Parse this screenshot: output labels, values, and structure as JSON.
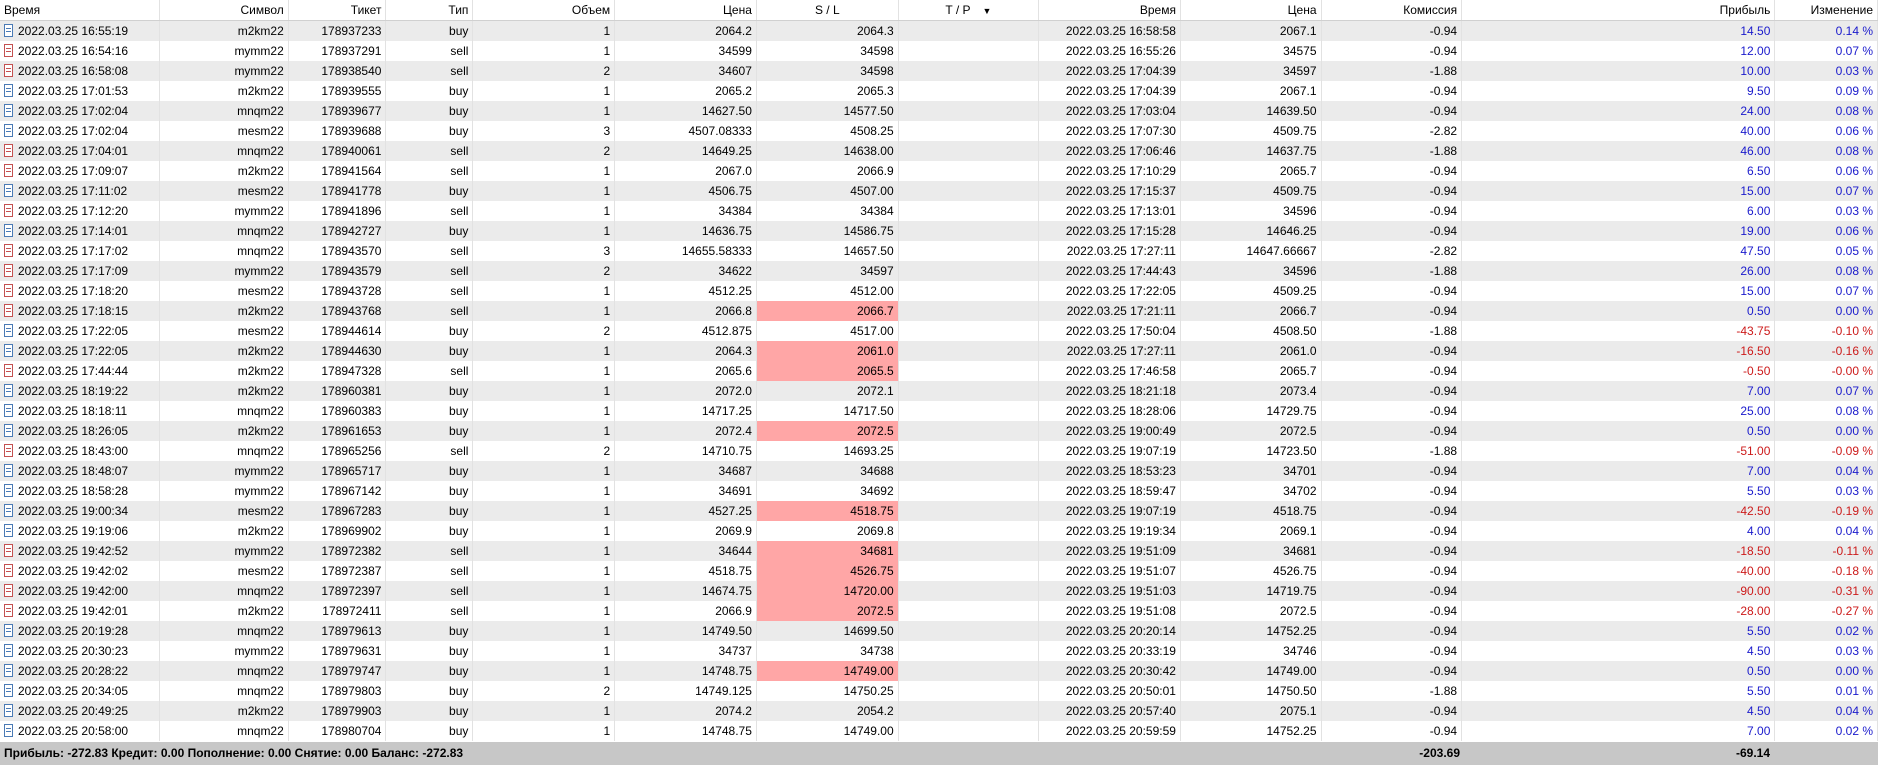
{
  "columns": [
    "Время",
    "Символ",
    "Тикет",
    "Тип",
    "Объем",
    "Цена",
    "S / L",
    "T / P",
    "Время",
    "Цена",
    "Комиссия",
    "Прибыль",
    "Изменение"
  ],
  "sort_indicator": "▼",
  "rows": [
    {
      "open_time": "2022.03.25 16:55:19",
      "symbol": "m2km22",
      "ticket": "178937233",
      "type": "buy",
      "volume": "1",
      "open_price": "2064.2",
      "sl": "2064.3",
      "tp": "",
      "close_time": "2022.03.25 16:58:58",
      "close_price": "2067.1",
      "commission": "-0.94",
      "profit": "14.50",
      "change": "0.14 %",
      "sl_hit": false
    },
    {
      "open_time": "2022.03.25 16:54:16",
      "symbol": "mymm22",
      "ticket": "178937291",
      "type": "sell",
      "volume": "1",
      "open_price": "34599",
      "sl": "34598",
      "tp": "",
      "close_time": "2022.03.25 16:55:26",
      "close_price": "34575",
      "commission": "-0.94",
      "profit": "12.00",
      "change": "0.07 %",
      "sl_hit": false
    },
    {
      "open_time": "2022.03.25 16:58:08",
      "symbol": "mymm22",
      "ticket": "178938540",
      "type": "sell",
      "volume": "2",
      "open_price": "34607",
      "sl": "34598",
      "tp": "",
      "close_time": "2022.03.25 17:04:39",
      "close_price": "34597",
      "commission": "-1.88",
      "profit": "10.00",
      "change": "0.03 %",
      "sl_hit": false
    },
    {
      "open_time": "2022.03.25 17:01:53",
      "symbol": "m2km22",
      "ticket": "178939555",
      "type": "buy",
      "volume": "1",
      "open_price": "2065.2",
      "sl": "2065.3",
      "tp": "",
      "close_time": "2022.03.25 17:04:39",
      "close_price": "2067.1",
      "commission": "-0.94",
      "profit": "9.50",
      "change": "0.09 %",
      "sl_hit": false
    },
    {
      "open_time": "2022.03.25 17:02:04",
      "symbol": "mnqm22",
      "ticket": "178939677",
      "type": "buy",
      "volume": "1",
      "open_price": "14627.50",
      "sl": "14577.50",
      "tp": "",
      "close_time": "2022.03.25 17:03:04",
      "close_price": "14639.50",
      "commission": "-0.94",
      "profit": "24.00",
      "change": "0.08 %",
      "sl_hit": false
    },
    {
      "open_time": "2022.03.25 17:02:04",
      "symbol": "mesm22",
      "ticket": "178939688",
      "type": "buy",
      "volume": "3",
      "open_price": "4507.08333",
      "sl": "4508.25",
      "tp": "",
      "close_time": "2022.03.25 17:07:30",
      "close_price": "4509.75",
      "commission": "-2.82",
      "profit": "40.00",
      "change": "0.06 %",
      "sl_hit": false
    },
    {
      "open_time": "2022.03.25 17:04:01",
      "symbol": "mnqm22",
      "ticket": "178940061",
      "type": "sell",
      "volume": "2",
      "open_price": "14649.25",
      "sl": "14638.00",
      "tp": "",
      "close_time": "2022.03.25 17:06:46",
      "close_price": "14637.75",
      "commission": "-1.88",
      "profit": "46.00",
      "change": "0.08 %",
      "sl_hit": false
    },
    {
      "open_time": "2022.03.25 17:09:07",
      "symbol": "m2km22",
      "ticket": "178941564",
      "type": "sell",
      "volume": "1",
      "open_price": "2067.0",
      "sl": "2066.9",
      "tp": "",
      "close_time": "2022.03.25 17:10:29",
      "close_price": "2065.7",
      "commission": "-0.94",
      "profit": "6.50",
      "change": "0.06 %",
      "sl_hit": false
    },
    {
      "open_time": "2022.03.25 17:11:02",
      "symbol": "mesm22",
      "ticket": "178941778",
      "type": "buy",
      "volume": "1",
      "open_price": "4506.75",
      "sl": "4507.00",
      "tp": "",
      "close_time": "2022.03.25 17:15:37",
      "close_price": "4509.75",
      "commission": "-0.94",
      "profit": "15.00",
      "change": "0.07 %",
      "sl_hit": false
    },
    {
      "open_time": "2022.03.25 17:12:20",
      "symbol": "mymm22",
      "ticket": "178941896",
      "type": "sell",
      "volume": "1",
      "open_price": "34384",
      "sl": "34384",
      "tp": "",
      "close_time": "2022.03.25 17:13:01",
      "close_price": "34596",
      "commission": "-0.94",
      "profit": "6.00",
      "change": "0.03 %",
      "sl_hit": false
    },
    {
      "open_time": "2022.03.25 17:14:01",
      "symbol": "mnqm22",
      "ticket": "178942727",
      "type": "buy",
      "volume": "1",
      "open_price": "14636.75",
      "sl": "14586.75",
      "tp": "",
      "close_time": "2022.03.25 17:15:28",
      "close_price": "14646.25",
      "commission": "-0.94",
      "profit": "19.00",
      "change": "0.06 %",
      "sl_hit": false
    },
    {
      "open_time": "2022.03.25 17:17:02",
      "symbol": "mnqm22",
      "ticket": "178943570",
      "type": "sell",
      "volume": "3",
      "open_price": "14655.58333",
      "sl": "14657.50",
      "tp": "",
      "close_time": "2022.03.25 17:27:11",
      "close_price": "14647.66667",
      "commission": "-2.82",
      "profit": "47.50",
      "change": "0.05 %",
      "sl_hit": false
    },
    {
      "open_time": "2022.03.25 17:17:09",
      "symbol": "mymm22",
      "ticket": "178943579",
      "type": "sell",
      "volume": "2",
      "open_price": "34622",
      "sl": "34597",
      "tp": "",
      "close_time": "2022.03.25 17:44:43",
      "close_price": "34596",
      "commission": "-1.88",
      "profit": "26.00",
      "change": "0.08 %",
      "sl_hit": false
    },
    {
      "open_time": "2022.03.25 17:18:20",
      "symbol": "mesm22",
      "ticket": "178943728",
      "type": "sell",
      "volume": "1",
      "open_price": "4512.25",
      "sl": "4512.00",
      "tp": "",
      "close_time": "2022.03.25 17:22:05",
      "close_price": "4509.25",
      "commission": "-0.94",
      "profit": "15.00",
      "change": "0.07 %",
      "sl_hit": false
    },
    {
      "open_time": "2022.03.25 17:18:15",
      "symbol": "m2km22",
      "ticket": "178943768",
      "type": "sell",
      "volume": "1",
      "open_price": "2066.8",
      "sl": "2066.7",
      "tp": "",
      "close_time": "2022.03.25 17:21:11",
      "close_price": "2066.7",
      "commission": "-0.94",
      "profit": "0.50",
      "change": "0.00 %",
      "sl_hit": true
    },
    {
      "open_time": "2022.03.25 17:22:05",
      "symbol": "mesm22",
      "ticket": "178944614",
      "type": "buy",
      "volume": "2",
      "open_price": "4512.875",
      "sl": "4517.00",
      "tp": "",
      "close_time": "2022.03.25 17:50:04",
      "close_price": "4508.50",
      "commission": "-1.88",
      "profit": "-43.75",
      "change": "-0.10 %",
      "sl_hit": false
    },
    {
      "open_time": "2022.03.25 17:22:05",
      "symbol": "m2km22",
      "ticket": "178944630",
      "type": "buy",
      "volume": "1",
      "open_price": "2064.3",
      "sl": "2061.0",
      "tp": "",
      "close_time": "2022.03.25 17:27:11",
      "close_price": "2061.0",
      "commission": "-0.94",
      "profit": "-16.50",
      "change": "-0.16 %",
      "sl_hit": true
    },
    {
      "open_time": "2022.03.25 17:44:44",
      "symbol": "m2km22",
      "ticket": "178947328",
      "type": "sell",
      "volume": "1",
      "open_price": "2065.6",
      "sl": "2065.5",
      "tp": "",
      "close_time": "2022.03.25 17:46:58",
      "close_price": "2065.7",
      "commission": "-0.94",
      "profit": "-0.50",
      "change": "-0.00 %",
      "sl_hit": true
    },
    {
      "open_time": "2022.03.25 18:19:22",
      "symbol": "m2km22",
      "ticket": "178960381",
      "type": "buy",
      "volume": "1",
      "open_price": "2072.0",
      "sl": "2072.1",
      "tp": "",
      "close_time": "2022.03.25 18:21:18",
      "close_price": "2073.4",
      "commission": "-0.94",
      "profit": "7.00",
      "change": "0.07 %",
      "sl_hit": false
    },
    {
      "open_time": "2022.03.25 18:18:11",
      "symbol": "mnqm22",
      "ticket": "178960383",
      "type": "buy",
      "volume": "1",
      "open_price": "14717.25",
      "sl": "14717.50",
      "tp": "",
      "close_time": "2022.03.25 18:28:06",
      "close_price": "14729.75",
      "commission": "-0.94",
      "profit": "25.00",
      "change": "0.08 %",
      "sl_hit": false
    },
    {
      "open_time": "2022.03.25 18:26:05",
      "symbol": "m2km22",
      "ticket": "178961653",
      "type": "buy",
      "volume": "1",
      "open_price": "2072.4",
      "sl": "2072.5",
      "tp": "",
      "close_time": "2022.03.25 19:00:49",
      "close_price": "2072.5",
      "commission": "-0.94",
      "profit": "0.50",
      "change": "0.00 %",
      "sl_hit": true
    },
    {
      "open_time": "2022.03.25 18:43:00",
      "symbol": "mnqm22",
      "ticket": "178965256",
      "type": "sell",
      "volume": "2",
      "open_price": "14710.75",
      "sl": "14693.25",
      "tp": "",
      "close_time": "2022.03.25 19:07:19",
      "close_price": "14723.50",
      "commission": "-1.88",
      "profit": "-51.00",
      "change": "-0.09 %",
      "sl_hit": false
    },
    {
      "open_time": "2022.03.25 18:48:07",
      "symbol": "mymm22",
      "ticket": "178965717",
      "type": "buy",
      "volume": "1",
      "open_price": "34687",
      "sl": "34688",
      "tp": "",
      "close_time": "2022.03.25 18:53:23",
      "close_price": "34701",
      "commission": "-0.94",
      "profit": "7.00",
      "change": "0.04 %",
      "sl_hit": false
    },
    {
      "open_time": "2022.03.25 18:58:28",
      "symbol": "mymm22",
      "ticket": "178967142",
      "type": "buy",
      "volume": "1",
      "open_price": "34691",
      "sl": "34692",
      "tp": "",
      "close_time": "2022.03.25 18:59:47",
      "close_price": "34702",
      "commission": "-0.94",
      "profit": "5.50",
      "change": "0.03 %",
      "sl_hit": false
    },
    {
      "open_time": "2022.03.25 19:00:34",
      "symbol": "mesm22",
      "ticket": "178967283",
      "type": "buy",
      "volume": "1",
      "open_price": "4527.25",
      "sl": "4518.75",
      "tp": "",
      "close_time": "2022.03.25 19:07:19",
      "close_price": "4518.75",
      "commission": "-0.94",
      "profit": "-42.50",
      "change": "-0.19 %",
      "sl_hit": true
    },
    {
      "open_time": "2022.03.25 19:19:06",
      "symbol": "m2km22",
      "ticket": "178969902",
      "type": "buy",
      "volume": "1",
      "open_price": "2069.9",
      "sl": "2069.8",
      "tp": "",
      "close_time": "2022.03.25 19:19:34",
      "close_price": "2069.1",
      "commission": "-0.94",
      "profit": "4.00",
      "change": "0.04 %",
      "sl_hit": false
    },
    {
      "open_time": "2022.03.25 19:42:52",
      "symbol": "mymm22",
      "ticket": "178972382",
      "type": "sell",
      "volume": "1",
      "open_price": "34644",
      "sl": "34681",
      "tp": "",
      "close_time": "2022.03.25 19:51:09",
      "close_price": "34681",
      "commission": "-0.94",
      "profit": "-18.50",
      "change": "-0.11 %",
      "sl_hit": true
    },
    {
      "open_time": "2022.03.25 19:42:02",
      "symbol": "mesm22",
      "ticket": "178972387",
      "type": "sell",
      "volume": "1",
      "open_price": "4518.75",
      "sl": "4526.75",
      "tp": "",
      "close_time": "2022.03.25 19:51:07",
      "close_price": "4526.75",
      "commission": "-0.94",
      "profit": "-40.00",
      "change": "-0.18 %",
      "sl_hit": true
    },
    {
      "open_time": "2022.03.25 19:42:00",
      "symbol": "mnqm22",
      "ticket": "178972397",
      "type": "sell",
      "volume": "1",
      "open_price": "14674.75",
      "sl": "14720.00",
      "tp": "",
      "close_time": "2022.03.25 19:51:03",
      "close_price": "14719.75",
      "commission": "-0.94",
      "profit": "-90.00",
      "change": "-0.31 %",
      "sl_hit": true
    },
    {
      "open_time": "2022.03.25 19:42:01",
      "symbol": "m2km22",
      "ticket": "178972411",
      "type": "sell",
      "volume": "1",
      "open_price": "2066.9",
      "sl": "2072.5",
      "tp": "",
      "close_time": "2022.03.25 19:51:08",
      "close_price": "2072.5",
      "commission": "-0.94",
      "profit": "-28.00",
      "change": "-0.27 %",
      "sl_hit": true
    },
    {
      "open_time": "2022.03.25 20:19:28",
      "symbol": "mnqm22",
      "ticket": "178979613",
      "type": "buy",
      "volume": "1",
      "open_price": "14749.50",
      "sl": "14699.50",
      "tp": "",
      "close_time": "2022.03.25 20:20:14",
      "close_price": "14752.25",
      "commission": "-0.94",
      "profit": "5.50",
      "change": "0.02 %",
      "sl_hit": false
    },
    {
      "open_time": "2022.03.25 20:30:23",
      "symbol": "mymm22",
      "ticket": "178979631",
      "type": "buy",
      "volume": "1",
      "open_price": "34737",
      "sl": "34738",
      "tp": "",
      "close_time": "2022.03.25 20:33:19",
      "close_price": "34746",
      "commission": "-0.94",
      "profit": "4.50",
      "change": "0.03 %",
      "sl_hit": false
    },
    {
      "open_time": "2022.03.25 20:28:22",
      "symbol": "mnqm22",
      "ticket": "178979747",
      "type": "buy",
      "volume": "1",
      "open_price": "14748.75",
      "sl": "14749.00",
      "tp": "",
      "close_time": "2022.03.25 20:30:42",
      "close_price": "14749.00",
      "commission": "-0.94",
      "profit": "0.50",
      "change": "0.00 %",
      "sl_hit": true
    },
    {
      "open_time": "2022.03.25 20:34:05",
      "symbol": "mnqm22",
      "ticket": "178979803",
      "type": "buy",
      "volume": "2",
      "open_price": "14749.125",
      "sl": "14750.25",
      "tp": "",
      "close_time": "2022.03.25 20:50:01",
      "close_price": "14750.50",
      "commission": "-1.88",
      "profit": "5.50",
      "change": "0.01 %",
      "sl_hit": false
    },
    {
      "open_time": "2022.03.25 20:49:25",
      "symbol": "m2km22",
      "ticket": "178979903",
      "type": "buy",
      "volume": "1",
      "open_price": "2074.2",
      "sl": "2054.2",
      "tp": "",
      "close_time": "2022.03.25 20:57:40",
      "close_price": "2075.1",
      "commission": "-0.94",
      "profit": "4.50",
      "change": "0.04 %",
      "sl_hit": false
    },
    {
      "open_time": "2022.03.25 20:58:00",
      "symbol": "mnqm22",
      "ticket": "178980704",
      "type": "buy",
      "volume": "1",
      "open_price": "14748.75",
      "sl": "14749.00",
      "tp": "",
      "close_time": "2022.03.25 20:59:59",
      "close_price": "14752.25",
      "commission": "-0.94",
      "profit": "7.00",
      "change": "0.02 %",
      "sl_hit": false
    }
  ],
  "summary": {
    "text": "Прибыль: -272.83  Кредит: 0.00  Пополнение: 0.00  Снятие: 0.00  Баланс: -272.83",
    "commission_total": "-203.69",
    "profit_total": "-69.14"
  },
  "colors": {
    "profit_positive": "#1a1acc",
    "profit_negative": "#cc1a1a",
    "sl_hit_bg": "#ffa6a6",
    "alt_row_bg": "#ebebeb",
    "summary_bg": "#c7c7c7"
  }
}
